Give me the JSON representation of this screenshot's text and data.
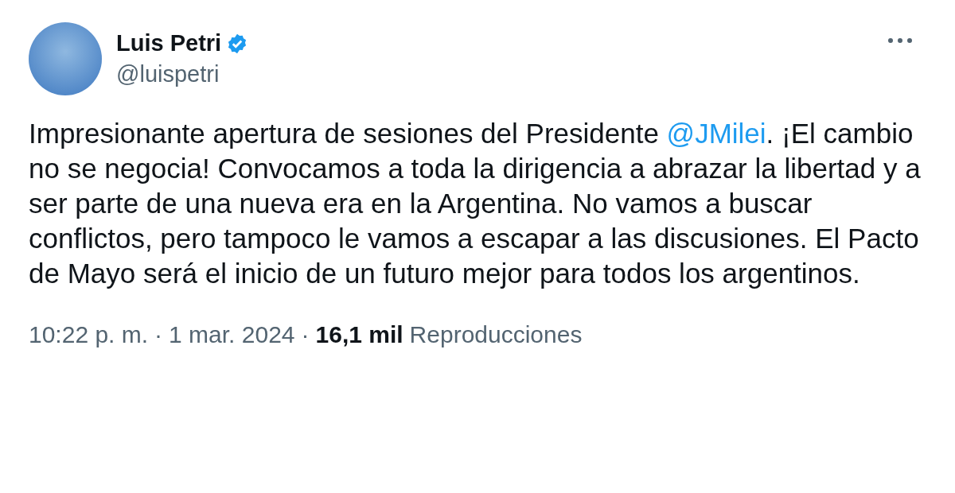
{
  "author": {
    "name": "Luis Petri",
    "verified": true,
    "handle": "@luispetri"
  },
  "body": [
    {
      "kind": "text",
      "text": "Impresionante apertura de sesiones del Presidente "
    },
    {
      "kind": "mention",
      "text": "@JMilei"
    },
    {
      "kind": "text",
      "text": ". ¡El cambio no se negocia! Convocamos a toda la dirigencia a abrazar la libertad y a ser parte de una nueva era en la Argentina. No vamos a buscar conflictos, pero tampoco le vamos a escapar a las discusiones. El Pacto de Mayo será el inicio de un futuro mejor para todos los argentinos."
    }
  ],
  "meta": {
    "time": "10:22 p. m.",
    "separator_1": "·",
    "date": "1 mar. 2024",
    "separator_2": "·",
    "views_count": "16,1 mil",
    "views_label": "Reproducciones"
  }
}
